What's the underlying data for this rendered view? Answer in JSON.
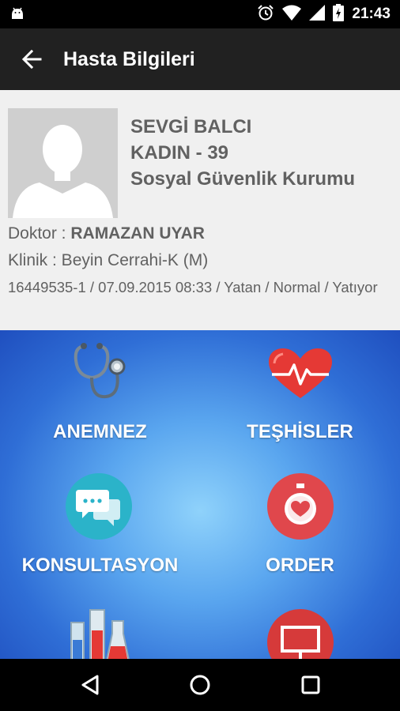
{
  "status_bar": {
    "time": "21:43",
    "icons": [
      "android-icon",
      "alarm-icon",
      "wifi-icon",
      "signal-icon",
      "battery-icon"
    ]
  },
  "app_bar": {
    "title": "Hasta Bilgileri",
    "back_icon": "arrow-back-icon"
  },
  "patient": {
    "name": "SEVGİ BALCI",
    "gender_age": "KADIN - 39",
    "insurance": "Sosyal Güvenlik Kurumu",
    "doctor_label": "Doktor : ",
    "doctor_name": "RAMAZAN UYAR",
    "clinic": "Klinik : Beyin Cerrahi-K (M)",
    "visit_info": "16449535-1 / 07.09.2015 08:33 / Yatan / Normal / Yatıyor"
  },
  "menu": {
    "items": [
      {
        "label": "ANEMNEZ",
        "icon": "stethoscope-icon"
      },
      {
        "label": "TEŞHİSLER",
        "icon": "heart-pulse-icon"
      },
      {
        "label": "KONSULTASYON",
        "icon": "chat-icon"
      },
      {
        "label": "ORDER",
        "icon": "stopwatch-heart-icon"
      },
      {
        "label": "",
        "icon": "lab-flasks-icon"
      },
      {
        "label": "",
        "icon": "monitor-icon"
      }
    ]
  },
  "colors": {
    "app_bar": "#212121",
    "patient_bg": "#f0f0f0",
    "text_gray": "#616161",
    "menu_center": "#8fd2fb",
    "menu_edge": "#1f4fbf",
    "heart_red": "#e53935",
    "chat_teal": "#2bb3c9",
    "order_red": "#e0474c"
  }
}
